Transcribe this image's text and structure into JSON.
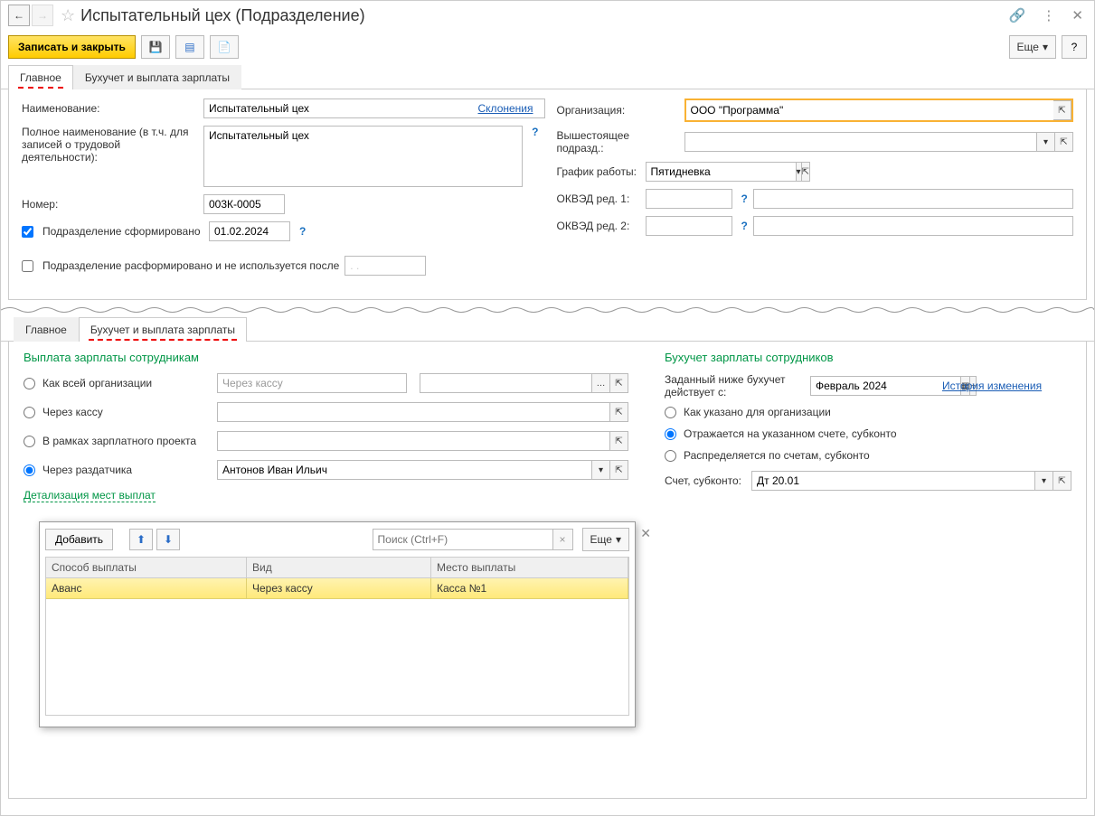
{
  "title": "Испытательный цех (Подразделение)",
  "toolbar": {
    "save_close": "Записать и закрыть",
    "more": "Еще"
  },
  "tabs_top": {
    "main": "Главное",
    "payroll": "Бухучет и выплата зарплаты"
  },
  "form": {
    "name_label": "Наименование:",
    "name_value": "Испытательный цех",
    "declensions": "Склонения",
    "fullname_label": "Полное наименование (в т.ч. для записей о трудовой деятельности):",
    "fullname_value": "Испытательный цех",
    "number_label": "Номер:",
    "number_value": "003К-0005",
    "formed_label": "Подразделение сформировано",
    "formed_date": "01.02.2024",
    "disbanded_label": "Подразделение расформировано и не используется после",
    "disbanded_date": ". .",
    "org_label": "Организация:",
    "org_value": "ООО \"Программа\"",
    "parent_label": "Вышестоящее подразд.:",
    "schedule_label": "График работы:",
    "schedule_value": "Пятидневка",
    "okved1_label": "ОКВЭД ред. 1:",
    "okved2_label": "ОКВЭД ред. 2:"
  },
  "payroll": {
    "left_title": "Выплата зарплаты сотрудникам",
    "opt_org": "Как всей организации",
    "opt_kassa": "Через кассу",
    "opt_project": "В рамках зарплатного проекта",
    "opt_dispatcher": "Через раздатчика",
    "kassa_placeholder": "Через кассу",
    "dispatcher_value": "Антонов Иван Ильич",
    "detail_link": "Детализация мест выплат",
    "right_title": "Бухучет зарплаты сотрудников",
    "effective_label": "Заданный ниже бухучет действует с:",
    "effective_value": "Февраль 2024",
    "history_link": "История изменения",
    "acc_opt_org": "Как указано для организации",
    "acc_opt_account": "Отражается на указанном счете, субконто",
    "acc_opt_distrib": "Распределяется по счетам, субконто",
    "account_label": "Счет, субконто:",
    "account_value": "Дт 20.01"
  },
  "popup": {
    "add": "Добавить",
    "search_placeholder": "Поиск (Ctrl+F)",
    "more": "Еще",
    "columns": {
      "method": "Способ выплаты",
      "kind": "Вид",
      "place": "Место выплаты"
    },
    "rows": [
      {
        "method": "Аванс",
        "kind": "Через кассу",
        "place": "Касса №1"
      }
    ]
  }
}
